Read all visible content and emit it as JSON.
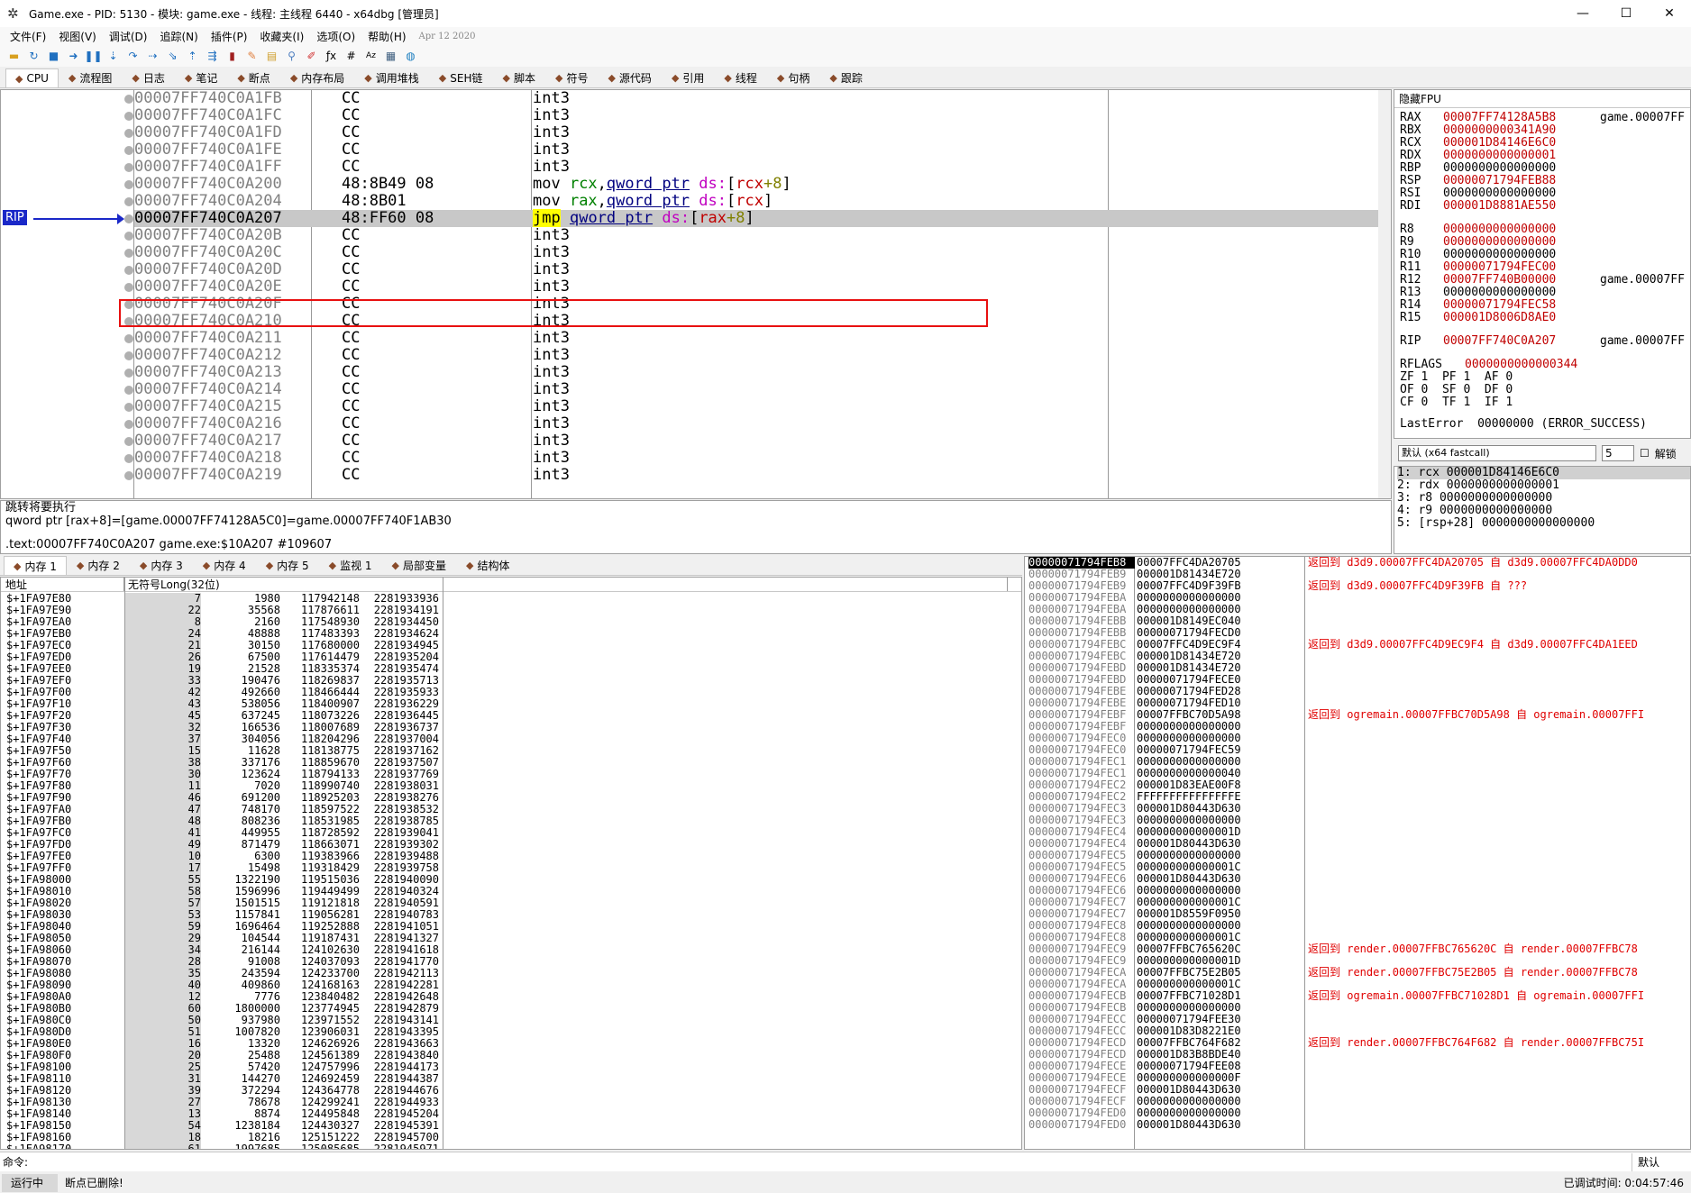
{
  "window": {
    "title": "Game.exe - PID: 5130 - 模块: game.exe - 线程: 主线程 6440 - x64dbg [管理员]",
    "min": "—",
    "max": "☐",
    "close": "✕"
  },
  "menu": [
    "文件(F)",
    "视图(V)",
    "调试(D)",
    "追踪(N)",
    "插件(P)",
    "收藏夹(I)",
    "选项(O)",
    "帮助(H)"
  ],
  "menu_date": "Apr 12 2020",
  "tabs": [
    "CPU",
    "流程图",
    "日志",
    "笔记",
    "断点",
    "内存布局",
    "调用堆栈",
    "SEH链",
    "脚本",
    "符号",
    "源代码",
    "引用",
    "线程",
    "句柄",
    "跟踪"
  ],
  "rip_label": "RIP",
  "disasm": [
    {
      "addr": "00007FF740C0A1FB",
      "bytes": "CC",
      "instr": "int3"
    },
    {
      "addr": "00007FF740C0A1FC",
      "bytes": "CC",
      "instr": "int3"
    },
    {
      "addr": "00007FF740C0A1FD",
      "bytes": "CC",
      "instr": "int3"
    },
    {
      "addr": "00007FF740C0A1FE",
      "bytes": "CC",
      "instr": "int3"
    },
    {
      "addr": "00007FF740C0A1FF",
      "bytes": "CC",
      "instr": "int3"
    },
    {
      "addr": "00007FF740C0A200",
      "bytes": "48:8B49 08",
      "instr": "mov rcx,qword ptr ds:[rcx+8]"
    },
    {
      "addr": "00007FF740C0A204",
      "bytes": "48:8B01",
      "instr": "mov rax,qword ptr ds:[rcx]"
    },
    {
      "addr": "00007FF740C0A207",
      "bytes": "48:FF60 08",
      "instr": "jmp qword ptr ds:[rax+8]"
    },
    {
      "addr": "00007FF740C0A20B",
      "bytes": "CC",
      "instr": "int3"
    },
    {
      "addr": "00007FF740C0A20C",
      "bytes": "CC",
      "instr": "int3"
    },
    {
      "addr": "00007FF740C0A20D",
      "bytes": "CC",
      "instr": "int3"
    },
    {
      "addr": "00007FF740C0A20E",
      "bytes": "CC",
      "instr": "int3"
    },
    {
      "addr": "00007FF740C0A20F",
      "bytes": "CC",
      "instr": "int3"
    },
    {
      "addr": "00007FF740C0A210",
      "bytes": "CC",
      "instr": "int3"
    },
    {
      "addr": "00007FF740C0A211",
      "bytes": "CC",
      "instr": "int3"
    },
    {
      "addr": "00007FF740C0A212",
      "bytes": "CC",
      "instr": "int3"
    },
    {
      "addr": "00007FF740C0A213",
      "bytes": "CC",
      "instr": "int3"
    },
    {
      "addr": "00007FF740C0A214",
      "bytes": "CC",
      "instr": "int3"
    },
    {
      "addr": "00007FF740C0A215",
      "bytes": "CC",
      "instr": "int3"
    },
    {
      "addr": "00007FF740C0A216",
      "bytes": "CC",
      "instr": "int3"
    },
    {
      "addr": "00007FF740C0A217",
      "bytes": "CC",
      "instr": "int3"
    },
    {
      "addr": "00007FF740C0A218",
      "bytes": "CC",
      "instr": "int3"
    },
    {
      "addr": "00007FF740C0A219",
      "bytes": "CC",
      "instr": "int3"
    }
  ],
  "info": {
    "line1": "跳转将要执行",
    "line2": "qword ptr [rax+8]=[game.00007FF74128A5C0]=game.00007FF740F1AB30",
    "line3": ".text:00007FF740C0A207 game.exe:$10A207 #109607"
  },
  "regs_header": "隐藏FPU",
  "registers": [
    {
      "name": "RAX",
      "value": "00007FF74128A5B8",
      "comment": "game.00007FF"
    },
    {
      "name": "RBX",
      "value": "0000000000341A90",
      "comment": ""
    },
    {
      "name": "RCX",
      "value": "000001D84146E6C0",
      "comment": ""
    },
    {
      "name": "RDX",
      "value": "0000000000000001",
      "comment": ""
    },
    {
      "name": "RBP",
      "value": "0000000000000000",
      "comment": ""
    },
    {
      "name": "RSP",
      "value": "00000071794FEB88",
      "comment": ""
    },
    {
      "name": "RSI",
      "value": "0000000000000000",
      "comment": ""
    },
    {
      "name": "RDI",
      "value": "000001D8881AE550",
      "comment": ""
    },
    {
      "name": "R8",
      "value": "0000000000000000",
      "comment": ""
    },
    {
      "name": "R9",
      "value": "0000000000000000",
      "comment": ""
    },
    {
      "name": "R10",
      "value": "0000000000000000",
      "comment": ""
    },
    {
      "name": "R11",
      "value": "00000071794FEC00",
      "comment": ""
    },
    {
      "name": "R12",
      "value": "00007FF740B00000",
      "comment": "game.00007FF"
    },
    {
      "name": "R13",
      "value": "0000000000000000",
      "comment": ""
    },
    {
      "name": "R14",
      "value": "00000071794FEC58",
      "comment": ""
    },
    {
      "name": "R15",
      "value": "000001D8006D8AE0",
      "comment": ""
    },
    {
      "name": "RIP",
      "value": "00007FF740C0A207",
      "comment": "game.00007FF"
    }
  ],
  "rflags": {
    "name": "RFLAGS",
    "value": "0000000000000344"
  },
  "flags": [
    "ZF 1  PF 1  AF 0",
    "OF 0  SF 0  DF 0",
    "CF 0  TF 1  IF 1"
  ],
  "lasterror": "LastError  00000000 (ERROR_SUCCESS)",
  "callconv": {
    "selected": "默认 (x64 fastcall)",
    "count": "5",
    "unlock": "解锁"
  },
  "args": [
    "1: rcx 000001D84146E6C0",
    "2: rdx 0000000000000001",
    "3: r8 0000000000000000",
    "4: r9 0000000000000000",
    "5: [rsp+28] 0000000000000000"
  ],
  "memtabs": [
    "内存 1",
    "内存 2",
    "内存 3",
    "内存 4",
    "内存 5",
    "监视 1",
    "局部变量",
    "结构体"
  ],
  "dump_header": {
    "addr": "地址",
    "value": "无符号Long(32位)"
  },
  "dump": [
    [
      "$+1FA97E80",
      "7",
      "1980",
      "117942148",
      "2281933936"
    ],
    [
      "$+1FA97E90",
      "22",
      "35568",
      "117876611",
      "2281934191"
    ],
    [
      "$+1FA97EA0",
      "8",
      "2160",
      "117548930",
      "2281934450"
    ],
    [
      "$+1FA97EB0",
      "24",
      "48888",
      "117483393",
      "2281934624"
    ],
    [
      "$+1FA97EC0",
      "21",
      "30150",
      "117680000",
      "2281934945"
    ],
    [
      "$+1FA97ED0",
      "26",
      "67500",
      "117614479",
      "2281935204"
    ],
    [
      "$+1FA97EE0",
      "19",
      "21528",
      "118335374",
      "2281935474"
    ],
    [
      "$+1FA97EF0",
      "33",
      "190476",
      "118269837",
      "2281935713"
    ],
    [
      "$+1FA97F00",
      "42",
      "492660",
      "118466444",
      "2281935933"
    ],
    [
      "$+1FA97F10",
      "43",
      "538056",
      "118400907",
      "2281936229"
    ],
    [
      "$+1FA97F20",
      "45",
      "637245",
      "118073226",
      "2281936445"
    ],
    [
      "$+1FA97F30",
      "32",
      "166536",
      "118007689",
      "2281936737"
    ],
    [
      "$+1FA97F40",
      "37",
      "304056",
      "118204296",
      "2281937004"
    ],
    [
      "$+1FA97F50",
      "15",
      "11628",
      "118138775",
      "2281937162"
    ],
    [
      "$+1FA97F60",
      "38",
      "337176",
      "118859670",
      "2281937507"
    ],
    [
      "$+1FA97F70",
      "30",
      "123624",
      "118794133",
      "2281937769"
    ],
    [
      "$+1FA97F80",
      "11",
      "7020",
      "118990740",
      "2281938031"
    ],
    [
      "$+1FA97F90",
      "46",
      "691200",
      "118925203",
      "2281938276"
    ],
    [
      "$+1FA97FA0",
      "47",
      "748170",
      "118597522",
      "2281938532"
    ],
    [
      "$+1FA97FB0",
      "48",
      "808236",
      "118531985",
      "2281938785"
    ],
    [
      "$+1FA97FC0",
      "41",
      "449955",
      "118728592",
      "2281939041"
    ],
    [
      "$+1FA97FD0",
      "49",
      "871479",
      "118663071",
      "2281939302"
    ],
    [
      "$+1FA97FE0",
      "10",
      "6300",
      "119383966",
      "2281939488"
    ],
    [
      "$+1FA97FF0",
      "17",
      "15498",
      "119318429",
      "2281939758"
    ],
    [
      "$+1FA98000",
      "55",
      "1322190",
      "119515036",
      "2281940090"
    ],
    [
      "$+1FA98010",
      "58",
      "1596996",
      "119449499",
      "2281940324"
    ],
    [
      "$+1FA98020",
      "57",
      "1501515",
      "119121818",
      "2281940591"
    ],
    [
      "$+1FA98030",
      "53",
      "1157841",
      "119056281",
      "2281940783"
    ],
    [
      "$+1FA98040",
      "59",
      "1696464",
      "119252888",
      "2281941051"
    ],
    [
      "$+1FA98050",
      "29",
      "104544",
      "119187431",
      "2281941327"
    ],
    [
      "$+1FA98060",
      "34",
      "216144",
      "124102630",
      "2281941618"
    ],
    [
      "$+1FA98070",
      "28",
      "91008",
      "124037093",
      "2281941770"
    ],
    [
      "$+1FA98080",
      "35",
      "243594",
      "124233700",
      "2281942113"
    ],
    [
      "$+1FA98090",
      "40",
      "409860",
      "124168163",
      "2281942281"
    ],
    [
      "$+1FA980A0",
      "12",
      "7776",
      "123840482",
      "2281942648"
    ],
    [
      "$+1FA980B0",
      "60",
      "1800000",
      "123774945",
      "2281942879"
    ],
    [
      "$+1FA980C0",
      "50",
      "937980",
      "123971552",
      "2281943141"
    ],
    [
      "$+1FA980D0",
      "51",
      "1007820",
      "123906031",
      "2281943395"
    ],
    [
      "$+1FA980E0",
      "16",
      "13320",
      "124626926",
      "2281943663"
    ],
    [
      "$+1FA980F0",
      "20",
      "25488",
      "124561389",
      "2281943840"
    ],
    [
      "$+1FA98100",
      "25",
      "57420",
      "124757996",
      "2281944173"
    ],
    [
      "$+1FA98110",
      "31",
      "144270",
      "124692459",
      "2281944387"
    ],
    [
      "$+1FA98120",
      "39",
      "372294",
      "124364778",
      "2281944676"
    ],
    [
      "$+1FA98130",
      "27",
      "78678",
      "124299241",
      "2281944933"
    ],
    [
      "$+1FA98140",
      "13",
      "8874",
      "124495848",
      "2281945204"
    ],
    [
      "$+1FA98150",
      "54",
      "1238184",
      "124430327",
      "2281945391"
    ],
    [
      "$+1FA98160",
      "18",
      "18216",
      "125151222",
      "2281945700"
    ],
    [
      "$+1FA98170",
      "61",
      "1997685",
      "125085685",
      "2281945971"
    ]
  ],
  "stack": [
    [
      "00000071794FEB8",
      "00007FFC4DA20705",
      "返回到 d3d9.00007FFC4DA20705 自 d3d9.00007FFC4DA0DD0"
    ],
    [
      "00000071794FEB9",
      "000001D81434E720",
      ""
    ],
    [
      "00000071794FEB9",
      "00007FFC4D9F39FB",
      "返回到 d3d9.00007FFC4D9F39FB 自 ???"
    ],
    [
      "00000071794FEBA",
      "0000000000000000",
      ""
    ],
    [
      "00000071794FEBA",
      "0000000000000000",
      ""
    ],
    [
      "00000071794FEBB",
      "000001D8149EC040",
      ""
    ],
    [
      "00000071794FEBB",
      "00000071794FECD0",
      ""
    ],
    [
      "00000071794FEBC",
      "00007FFC4D9EC9F4",
      "返回到 d3d9.00007FFC4D9EC9F4 自 d3d9.00007FFC4DA1EED"
    ],
    [
      "00000071794FEBC",
      "000001D81434E720",
      ""
    ],
    [
      "00000071794FEBD",
      "000001D81434E720",
      ""
    ],
    [
      "00000071794FEBD",
      "00000071794FECE0",
      ""
    ],
    [
      "00000071794FEBE",
      "00000071794FED28",
      ""
    ],
    [
      "00000071794FEBE",
      "00000071794FED10",
      ""
    ],
    [
      "00000071794FEBF",
      "00007FFBC70D5A98",
      "返回到 ogremain.00007FFBC70D5A98 自 ogremain.00007FFI"
    ],
    [
      "00000071794FEBF",
      "0000000000000000",
      ""
    ],
    [
      "00000071794FEC0",
      "0000000000000000",
      ""
    ],
    [
      "00000071794FEC0",
      "00000071794FEC59",
      ""
    ],
    [
      "00000071794FEC1",
      "0000000000000000",
      ""
    ],
    [
      "00000071794FEC1",
      "0000000000000040",
      ""
    ],
    [
      "00000071794FEC2",
      "000001D83EAE00F8",
      ""
    ],
    [
      "00000071794FEC2",
      "FFFFFFFFFFFFFFFE",
      ""
    ],
    [
      "00000071794FEC3",
      "000001D80443D630",
      ""
    ],
    [
      "00000071794FEC3",
      "0000000000000000",
      ""
    ],
    [
      "00000071794FEC4",
      "000000000000001D",
      ""
    ],
    [
      "00000071794FEC4",
      "000001D80443D630",
      ""
    ],
    [
      "00000071794FEC5",
      "0000000000000000",
      ""
    ],
    [
      "00000071794FEC5",
      "000000000000001C",
      ""
    ],
    [
      "00000071794FEC6",
      "000001D80443D630",
      ""
    ],
    [
      "00000071794FEC6",
      "0000000000000000",
      ""
    ],
    [
      "00000071794FEC7",
      "000000000000001C",
      ""
    ],
    [
      "00000071794FEC7",
      "000001D8559F0950",
      ""
    ],
    [
      "00000071794FEC8",
      "0000000000000000",
      ""
    ],
    [
      "00000071794FEC8",
      "000000000000001C",
      ""
    ],
    [
      "00000071794FEC9",
      "00007FFBC765620C",
      "返回到 render.00007FFBC765620C 自 render.00007FFBC78"
    ],
    [
      "00000071794FEC9",
      "000000000000001D",
      ""
    ],
    [
      "00000071794FECA",
      "00007FFBC75E2B05",
      "返回到 render.00007FFBC75E2B05 自 render.00007FFBC78"
    ],
    [
      "00000071794FECA",
      "000000000000001C",
      ""
    ],
    [
      "00000071794FECB",
      "00007FFBC71028D1",
      "返回到 ogremain.00007FFBC71028D1 自 ogremain.00007FFI"
    ],
    [
      "00000071794FECB",
      "0000000000000000",
      ""
    ],
    [
      "00000071794FECC",
      "00000071794FEE30",
      ""
    ],
    [
      "00000071794FECC",
      "000001D83D8221E0",
      ""
    ],
    [
      "00000071794FECD",
      "00007FFBC764F682",
      "返回到 render.00007FFBC764F682 自 render.00007FFBC75I"
    ],
    [
      "00000071794FECD",
      "000001D83B8BDE40",
      ""
    ],
    [
      "00000071794FECE",
      "00000071794FEE08",
      ""
    ],
    [
      "00000071794FECE",
      "000000000000000F",
      ""
    ],
    [
      "00000071794FECF",
      "000001D80443D630",
      ""
    ],
    [
      "00000071794FECF",
      "0000000000000000",
      ""
    ],
    [
      "00000071794FED0",
      "0000000000000000",
      ""
    ],
    [
      "00000071794FED0",
      "000001D80443D630",
      ""
    ]
  ],
  "cmd": {
    "label": "命令:",
    "default": "默认"
  },
  "status": {
    "state": "运行中",
    "message": "断点已删除!",
    "time": "已调试时间:  0:04:57:46"
  }
}
